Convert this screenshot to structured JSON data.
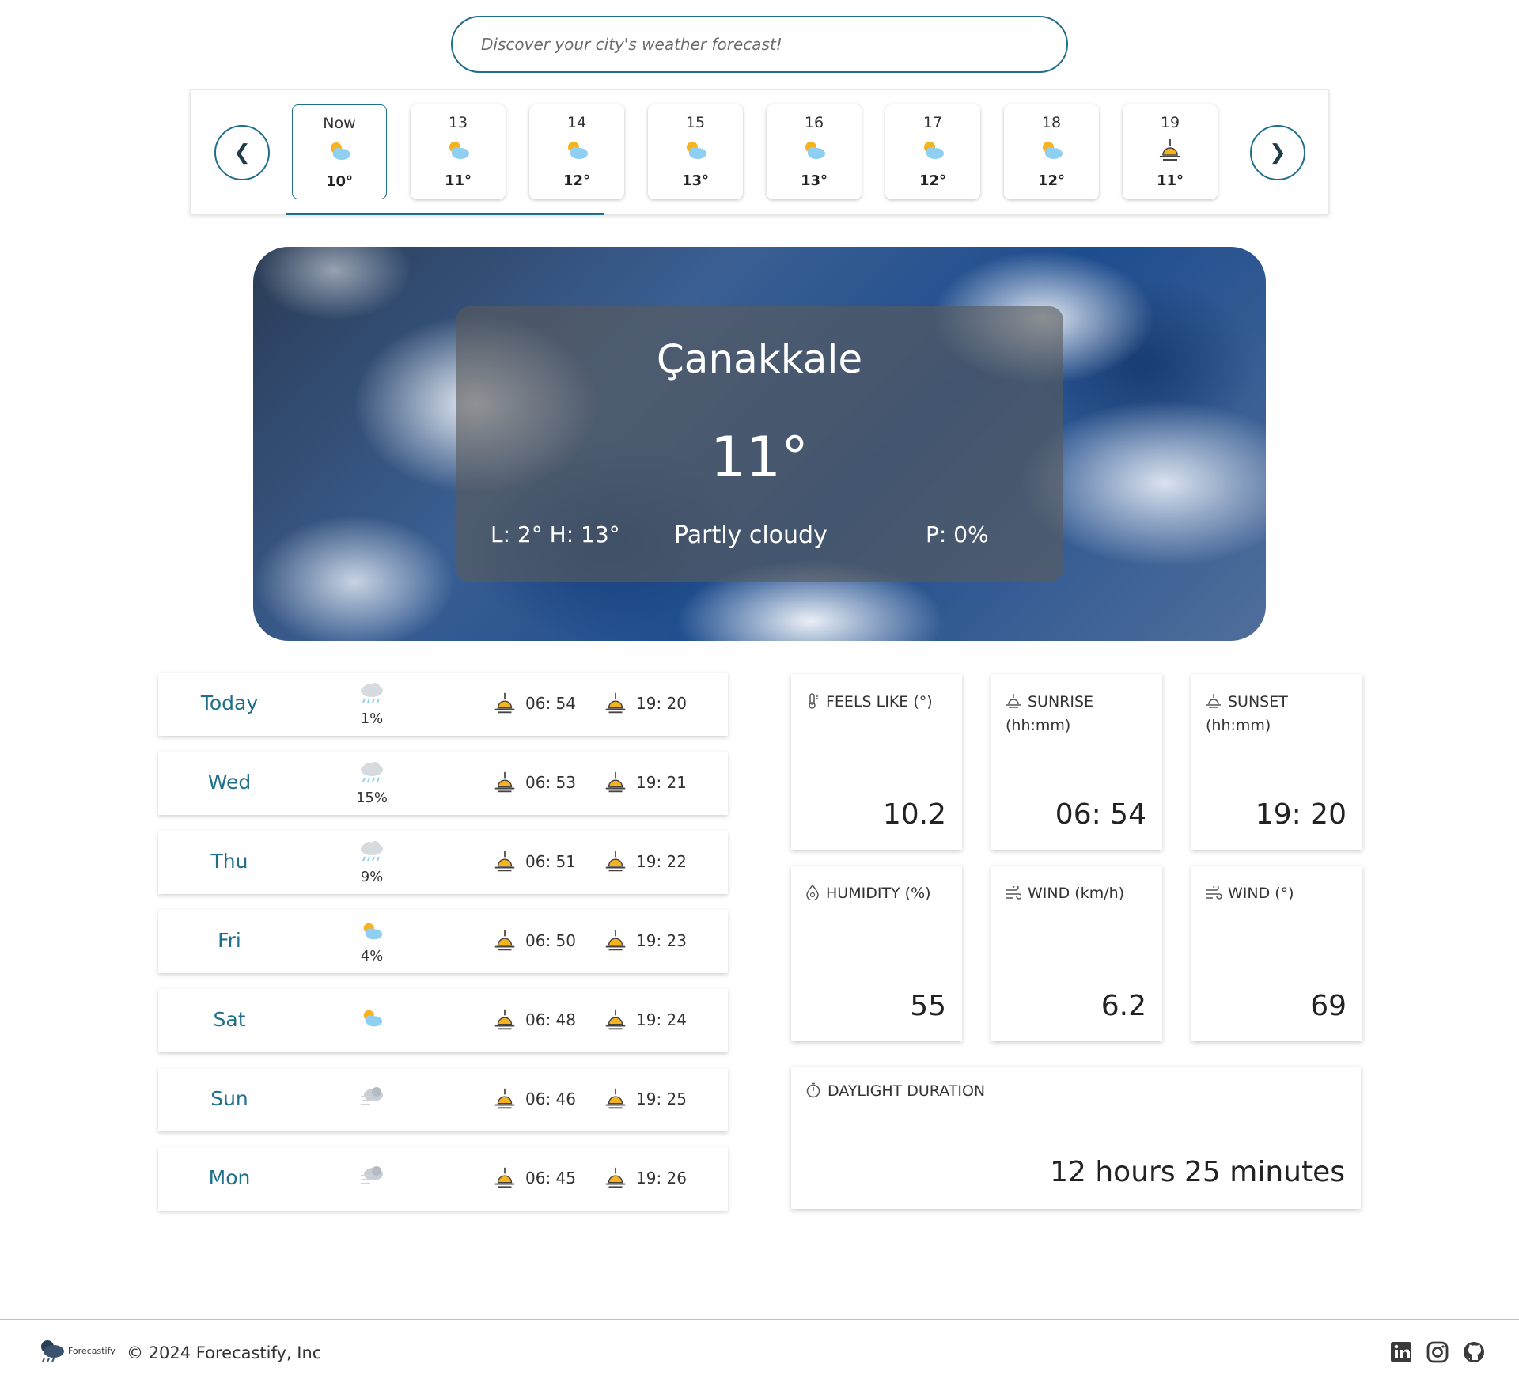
{
  "search": {
    "placeholder": "Discover your city's weather forecast!"
  },
  "hourly": {
    "prev_label": "❮",
    "next_label": "❯",
    "items": [
      {
        "label": "Now",
        "temp": "10°",
        "icon": "partly-cloudy-day-icon"
      },
      {
        "label": "13",
        "temp": "11°",
        "icon": "partly-cloudy-day-icon"
      },
      {
        "label": "14",
        "temp": "12°",
        "icon": "partly-cloudy-day-icon"
      },
      {
        "label": "15",
        "temp": "13°",
        "icon": "partly-cloudy-day-icon"
      },
      {
        "label": "16",
        "temp": "13°",
        "icon": "partly-cloudy-day-icon"
      },
      {
        "label": "17",
        "temp": "12°",
        "icon": "partly-cloudy-day-icon"
      },
      {
        "label": "18",
        "temp": "12°",
        "icon": "partly-cloudy-day-icon"
      },
      {
        "label": "19",
        "temp": "11°",
        "icon": "sunset-icon"
      }
    ]
  },
  "current": {
    "city": "Çanakkale",
    "temp": "11°",
    "low_high": "L: 2°  H: 13°",
    "condition": "Partly cloudy",
    "precip": "P: 0%"
  },
  "daily": [
    {
      "day": "Today",
      "icon": "rain-cloud-icon",
      "precip": "1%",
      "sunrise": "06: 54",
      "sunset": "19: 20"
    },
    {
      "day": "Wed",
      "icon": "rain-cloud-icon",
      "precip": "15%",
      "sunrise": "06: 53",
      "sunset": "19: 21"
    },
    {
      "day": "Thu",
      "icon": "rain-cloud-icon",
      "precip": "9%",
      "sunrise": "06: 51",
      "sunset": "19: 22"
    },
    {
      "day": "Fri",
      "icon": "partly-cloudy-day-icon",
      "precip": "4%",
      "sunrise": "06: 50",
      "sunset": "19: 23"
    },
    {
      "day": "Sat",
      "icon": "partly-cloudy-day-icon",
      "precip": "",
      "sunrise": "06: 48",
      "sunset": "19: 24"
    },
    {
      "day": "Sun",
      "icon": "windy-cloud-icon",
      "precip": "",
      "sunrise": "06: 46",
      "sunset": "19: 25"
    },
    {
      "day": "Mon",
      "icon": "windy-cloud-icon",
      "precip": "",
      "sunrise": "06: 45",
      "sunset": "19: 26"
    }
  ],
  "stats": {
    "feels_like": {
      "label": "FEELS LIKE (°)",
      "value": "10.2",
      "icon": "thermometer-icon"
    },
    "sunrise": {
      "label": "SUNRISE (hh:mm)",
      "value": "06: 54",
      "icon": "sunrise-icon"
    },
    "sunset": {
      "label": "SUNSET (hh:mm)",
      "value": "19: 20",
      "icon": "sunset-icon"
    },
    "humidity": {
      "label": "HUMIDITY (%)",
      "value": "55",
      "icon": "droplet-icon"
    },
    "wind_speed": {
      "label": "WIND (km/h)",
      "value": "6.2",
      "icon": "wind-icon"
    },
    "wind_dir": {
      "label": "WIND (°)",
      "value": "69",
      "icon": "wind-icon"
    },
    "daylight": {
      "label": "DAYLIGHT DURATION",
      "value": "12 hours 25 minutes",
      "icon": "stopwatch-icon"
    }
  },
  "footer": {
    "logo_text": "Forecastify",
    "copyright": "© 2024 Forecastify, Inc",
    "social": [
      "linkedin-icon",
      "instagram-icon",
      "github-icon"
    ]
  },
  "colors": {
    "accent": "#1f6f8b",
    "sun": "#f6b321",
    "cloud": "#8fd0f2"
  }
}
